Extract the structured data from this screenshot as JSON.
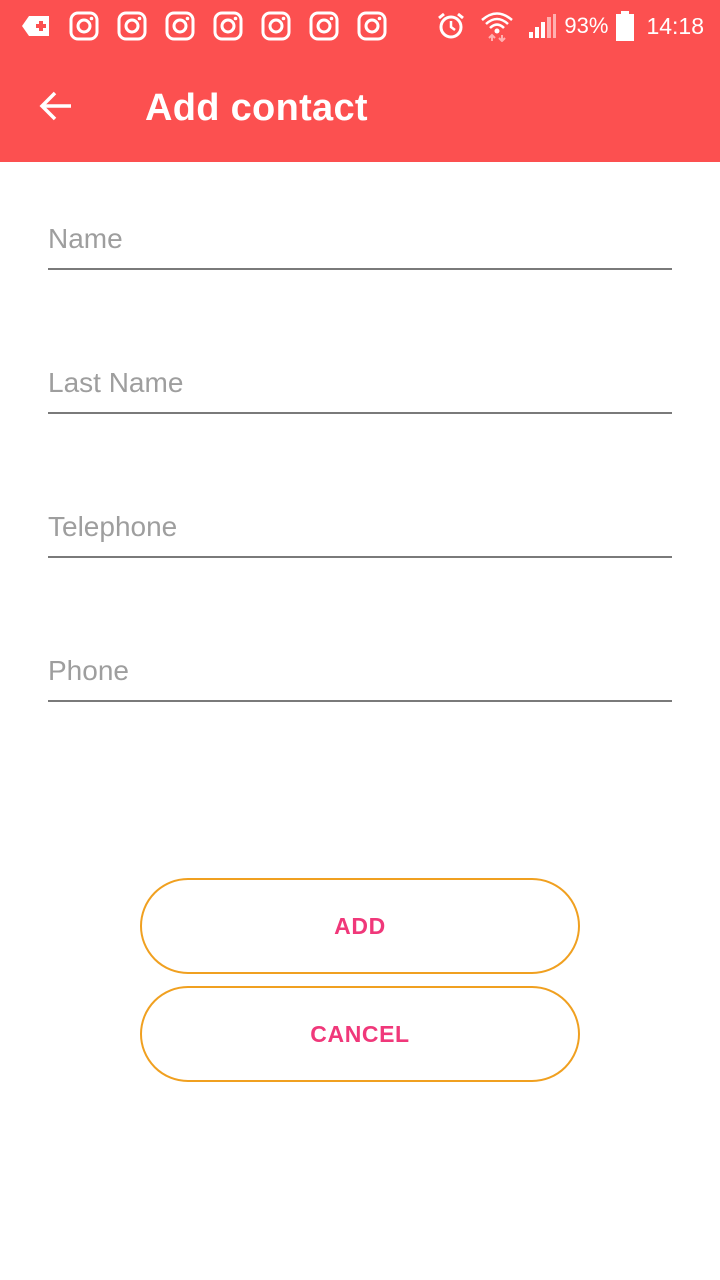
{
  "status_bar": {
    "notification_icons": [
      "medical-kit-icon",
      "instagram-icon",
      "instagram-icon",
      "instagram-icon",
      "instagram-icon",
      "instagram-icon",
      "instagram-icon",
      "instagram-icon"
    ],
    "alarm_icon": "alarm-clock-icon",
    "wifi_icon": "wifi-icon",
    "signal_icon": "cell-signal-icon",
    "battery_percent": "93%",
    "battery_icon": "battery-icon",
    "time": "14:18"
  },
  "toolbar": {
    "back_icon": "arrow-back-icon",
    "title": "Add contact"
  },
  "form": {
    "fields": [
      {
        "placeholder": "Name",
        "value": ""
      },
      {
        "placeholder": "Last Name",
        "value": ""
      },
      {
        "placeholder": "Telephone",
        "value": ""
      },
      {
        "placeholder": "Phone",
        "value": ""
      }
    ]
  },
  "actions": {
    "add_label": "ADD",
    "cancel_label": "CANCEL"
  },
  "colors": {
    "primary": "#fc5050",
    "button_border": "#f0a020",
    "button_text": "#f0387a",
    "underline": "#7a7a7a",
    "placeholder": "#9e9e9e"
  }
}
